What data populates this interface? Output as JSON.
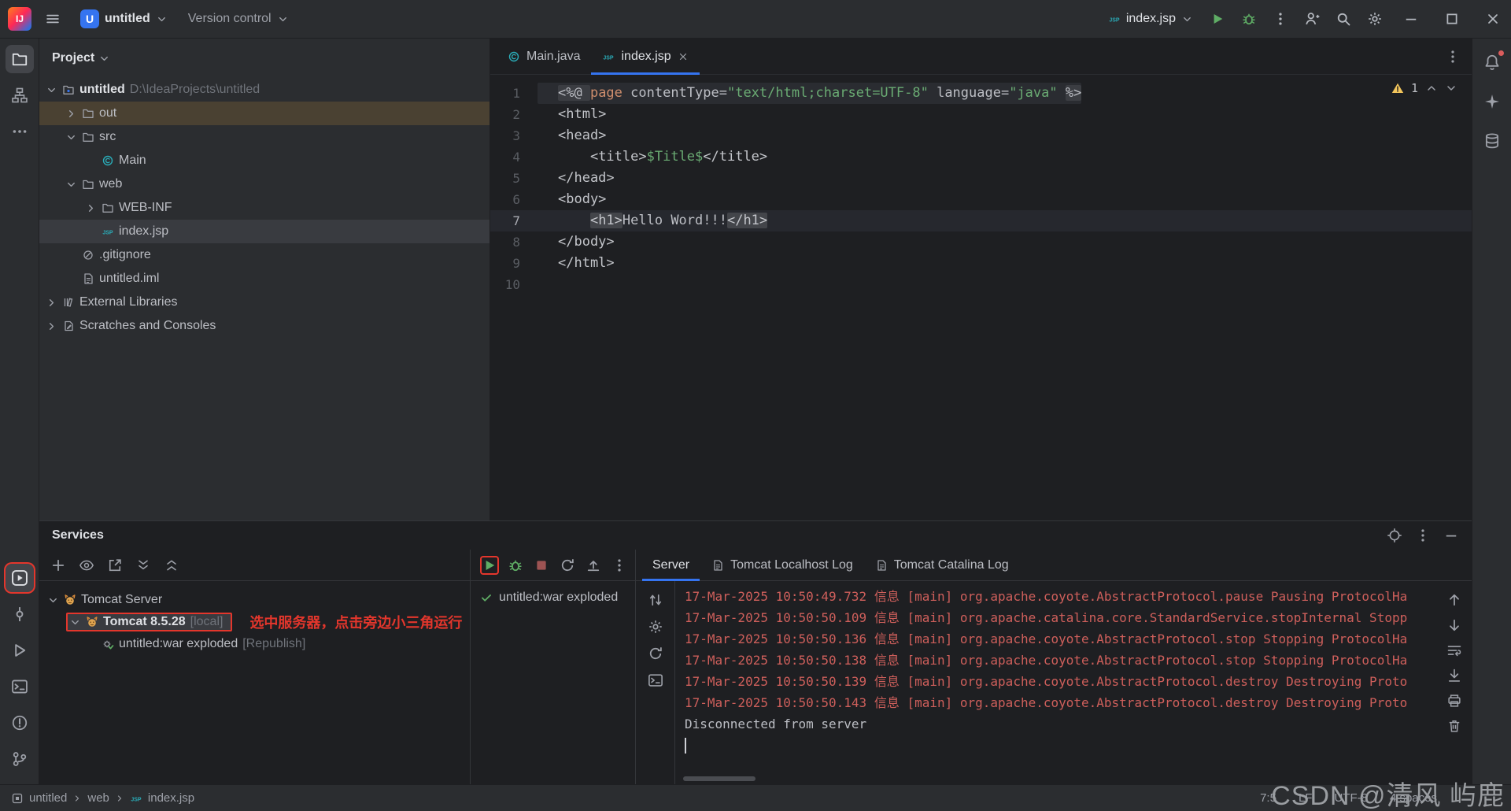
{
  "colors": {
    "accent_blue": "#3574f0",
    "run_green": "#5fad65",
    "log_error_red": "#ce5f5b",
    "annotation_red": "#e3362c",
    "warning_yellow": "#f2c55c"
  },
  "titlebar": {
    "project_badge": "U",
    "project": "untitled",
    "version_control": "Version control",
    "run_config": "index.jsp"
  },
  "project_panel": {
    "header": "Project",
    "tree": [
      {
        "level": 0,
        "chevron": "down",
        "icon": "project",
        "label": "untitled",
        "suffix": "D:\\IdeaProjects\\untitled",
        "bold": true
      },
      {
        "level": 1,
        "chevron": "right",
        "icon": "folder",
        "label": "out",
        "highlight": "warm"
      },
      {
        "level": 1,
        "chevron": "down",
        "icon": "folder",
        "label": "src"
      },
      {
        "level": 2,
        "chevron": "none",
        "icon": "class",
        "label": "Main"
      },
      {
        "level": 1,
        "chevron": "down",
        "icon": "folder",
        "label": "web"
      },
      {
        "level": 2,
        "chevron": "right",
        "icon": "folder",
        "label": "WEB-INF"
      },
      {
        "level": 2,
        "chevron": "none",
        "icon": "jsp",
        "label": "index.jsp",
        "highlight": "selected"
      },
      {
        "level": 1,
        "chevron": "none",
        "icon": "gitignore",
        "label": ".gitignore"
      },
      {
        "level": 1,
        "chevron": "none",
        "icon": "file",
        "label": "untitled.iml"
      },
      {
        "level": 0,
        "chevron": "right",
        "icon": "libraries",
        "label": "External Libraries"
      },
      {
        "level": 0,
        "chevron": "right",
        "icon": "scratches",
        "label": "Scratches and Consoles"
      }
    ]
  },
  "editor": {
    "tabs": [
      {
        "label": "Main.java"
      },
      {
        "label": "index.jsp"
      }
    ],
    "warning_count": "1",
    "lines": [
      {
        "n": 1,
        "frag": true,
        "segs": [
          {
            "t": "<%@ ",
            "c": "dir"
          },
          {
            "t": "page",
            "c": "kw"
          },
          {
            "t": " contentType=",
            "c": "pln"
          },
          {
            "t": "\"text/html;charset=UTF-8\"",
            "c": "str"
          },
          {
            "t": " language=",
            "c": "pln"
          },
          {
            "t": "\"java\"",
            "c": "str"
          },
          {
            "t": " ",
            "c": "pln"
          },
          {
            "t": "%>",
            "c": "dir"
          }
        ]
      },
      {
        "n": 2,
        "segs": [
          {
            "t": "<html>",
            "c": "tag"
          }
        ]
      },
      {
        "n": 3,
        "segs": [
          {
            "t": "<head>",
            "c": "tag"
          }
        ]
      },
      {
        "n": 4,
        "segs": [
          {
            "t": "    ",
            "c": "pln"
          },
          {
            "t": "<title>",
            "c": "tag"
          },
          {
            "t": "$Title$",
            "c": "var"
          },
          {
            "t": "</title>",
            "c": "tag"
          }
        ]
      },
      {
        "n": 5,
        "segs": [
          {
            "t": "</head>",
            "c": "tag"
          }
        ]
      },
      {
        "n": 6,
        "segs": [
          {
            "t": "<body>",
            "c": "tag"
          }
        ]
      },
      {
        "n": 7,
        "current": true,
        "segs": [
          {
            "t": "    ",
            "c": "pln"
          },
          {
            "t": "<h1>",
            "c": "tag mt"
          },
          {
            "t": "Hello Word!!!",
            "c": "pln"
          },
          {
            "t": "</h1>",
            "c": "tag mt"
          }
        ]
      },
      {
        "n": 8,
        "segs": [
          {
            "t": "</body>",
            "c": "tag"
          }
        ]
      },
      {
        "n": 9,
        "segs": [
          {
            "t": "</html>",
            "c": "tag"
          }
        ]
      },
      {
        "n": 10,
        "segs": []
      }
    ]
  },
  "services": {
    "title": "Services",
    "tree": [
      {
        "level": 0,
        "chevron": "down",
        "icon": "tomcat",
        "label": "Tomcat Server"
      },
      {
        "level": 1,
        "chevron": "down",
        "icon": "tomcat",
        "label": "Tomcat 8.5.28",
        "suffix": "[local]",
        "bold": true,
        "annotated": true
      },
      {
        "level": 2,
        "chevron": "none",
        "icon": "deployed",
        "label": "untitled:war exploded",
        "suffix": "[Republish]"
      }
    ],
    "annotation_tip": "选中服务器，点击旁边小三角运行",
    "deploy_status": "untitled:war exploded",
    "tabs": [
      {
        "label": "Server",
        "active": true
      },
      {
        "label": "Tomcat Localhost Log",
        "icon": "logfile"
      },
      {
        "label": "Tomcat Catalina Log",
        "icon": "logfile"
      }
    ],
    "log": [
      {
        "type": "error",
        "text": "17-Mar-2025 10:50:49.732 信息 [main] org.apache.coyote.AbstractProtocol.pause Pausing ProtocolHa"
      },
      {
        "type": "error",
        "text": "17-Mar-2025 10:50:50.109 信息 [main] org.apache.catalina.core.StandardService.stopInternal Stopp"
      },
      {
        "type": "error",
        "text": "17-Mar-2025 10:50:50.136 信息 [main] org.apache.coyote.AbstractProtocol.stop Stopping ProtocolHa"
      },
      {
        "type": "error",
        "text": "17-Mar-2025 10:50:50.138 信息 [main] org.apache.coyote.AbstractProtocol.stop Stopping ProtocolHa"
      },
      {
        "type": "error",
        "text": "17-Mar-2025 10:50:50.139 信息 [main] org.apache.coyote.AbstractProtocol.destroy Destroying Proto"
      },
      {
        "type": "error",
        "text": "17-Mar-2025 10:50:50.143 信息 [main] org.apache.coyote.AbstractProtocol.destroy Destroying Proto"
      },
      {
        "type": "plain",
        "text": "Disconnected from server"
      }
    ]
  },
  "statusbar": {
    "breadcrumbs": [
      "untitled",
      "web",
      "index.jsp"
    ],
    "items": [
      "7:5",
      "LF",
      "UTF-8",
      "4 spaces"
    ]
  },
  "watermark": "CSDN @清风 屿鹿"
}
